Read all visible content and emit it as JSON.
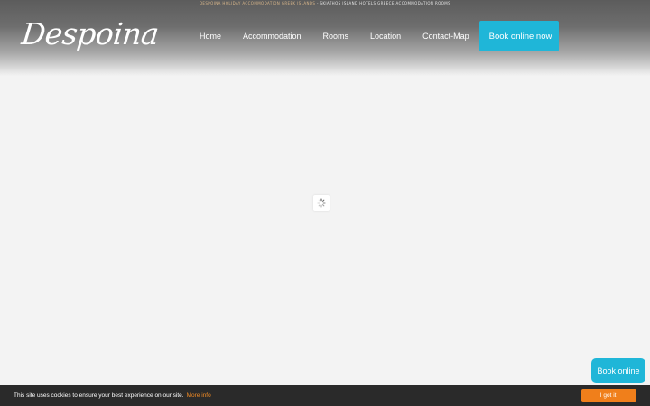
{
  "header": {
    "tagline_part1": "DESPOINA HOLIDAY ACCOMMODATION GREEK ISLANDS",
    "tagline_separator": " - ",
    "tagline_part2": "SKIATHOS ISLAND HOTELS GREECE ACCOMMODATION ROOMS",
    "logo_text": "Despoina"
  },
  "nav": {
    "items": [
      {
        "label": "Home",
        "active": true
      },
      {
        "label": "Accommodation"
      },
      {
        "label": "Rooms"
      },
      {
        "label": "Location"
      },
      {
        "label": "Contact-Map"
      }
    ],
    "book_button": {
      "icon": "",
      "label": "Book online now"
    }
  },
  "loader": {
    "icon": "spinner-icon"
  },
  "floating_book": {
    "label": "Book online"
  },
  "cookie_bar": {
    "message": "This site uses cookies to ensure your best experience on our site.",
    "more_info_label": "More info",
    "accept_label": "I got it!"
  },
  "colors": {
    "accent_blue": "#1fb6d8",
    "accept_orange": "#f07f1b",
    "page_background": "#f3f3f3",
    "cookie_background": "#2a2a2a"
  }
}
